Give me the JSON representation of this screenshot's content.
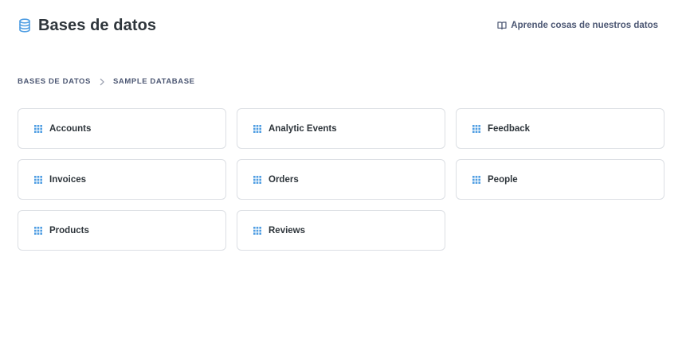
{
  "header": {
    "title": "Bases de datos",
    "title_icon": "database-icon",
    "learn_link": "Aprende cosas de nuestros datos",
    "learn_icon": "book-icon"
  },
  "breadcrumb": {
    "items": [
      "BASES DE DATOS",
      "SAMPLE DATABASE"
    ],
    "separator_icon": "chevron-right-icon"
  },
  "tables": {
    "icon": "table-icon",
    "items": [
      "Accounts",
      "Analytic Events",
      "Feedback",
      "Invoices",
      "Orders",
      "People",
      "Products",
      "Reviews"
    ]
  },
  "colors": {
    "accent": "#509ee3",
    "border": "#dcdfe4",
    "text_dark": "#2e353b",
    "text_medium": "#4c5773"
  }
}
